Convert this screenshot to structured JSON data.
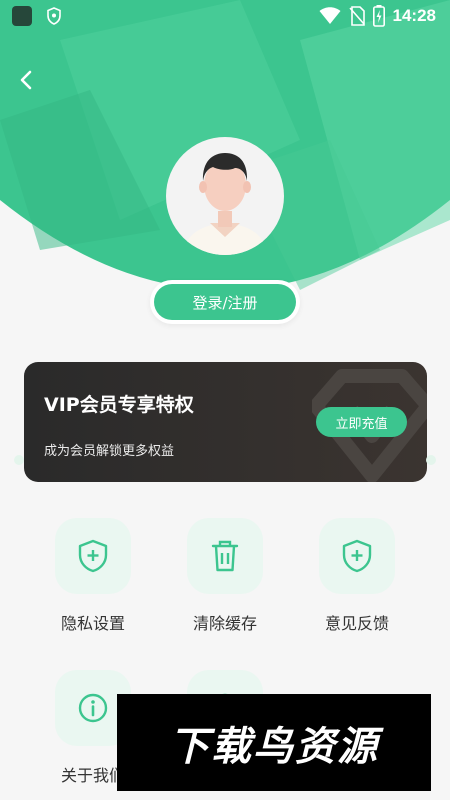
{
  "status_bar": {
    "time": "14:28",
    "icons": [
      "app-icon",
      "shield-icon",
      "wifi-icon",
      "no-sim-icon",
      "battery-icon"
    ]
  },
  "header": {
    "back_icon": "chevron-left-icon",
    "avatar_icon": "default-avatar-icon",
    "login_label": "登录/注册",
    "bg_color": "#3cc58f"
  },
  "vip_card": {
    "title": "VIP会员专享特权",
    "subtitle": "成为会员解锁更多权益",
    "button_label": "立即充值",
    "accent": "#3cc58f"
  },
  "grid": [
    {
      "label": "隐私设置",
      "icon": "shield-plus-icon"
    },
    {
      "label": "清除缓存",
      "icon": "trash-icon"
    },
    {
      "label": "意见反馈",
      "icon": "shield-plus-icon"
    },
    {
      "label": "关于我们",
      "icon": "info-icon"
    },
    {
      "label": "",
      "icon": "partially-hidden-icon"
    }
  ],
  "watermark": "下载鸟资源"
}
